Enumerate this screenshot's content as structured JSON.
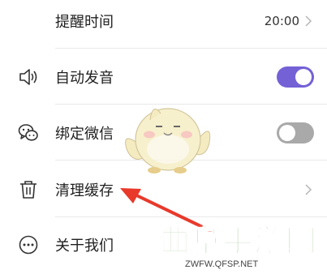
{
  "settings": {
    "rows": [
      {
        "label": "提醒时间",
        "value": "20:00",
        "icon": "none",
        "control": "chevron"
      },
      {
        "label": "自动发音",
        "icon": "speaker-icon",
        "control": "toggle",
        "toggle_on": true
      },
      {
        "label": "绑定微信",
        "icon": "wechat-icon",
        "control": "toggle",
        "toggle_on": false
      },
      {
        "label": "清理缓存",
        "icon": "trash-icon",
        "control": "chevron"
      },
      {
        "label": "关于我们",
        "icon": "more-dots-icon",
        "control": "none"
      }
    ]
  },
  "colors": {
    "toggle_on": "#7561d6",
    "toggle_off": "#a9a9a9",
    "arrow": "#e8392b",
    "watermark": "#2f8a1e"
  },
  "overlay": {
    "watermark_title": "曲阜手游网",
    "watermark_url": "ZWFW.QFSP.NET"
  }
}
